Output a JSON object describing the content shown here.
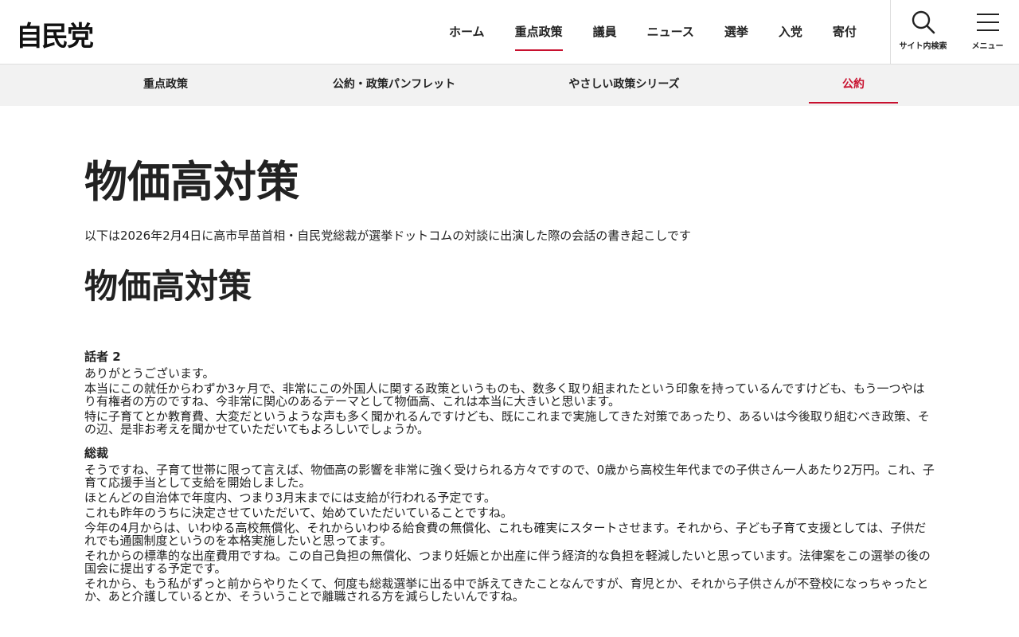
{
  "header": {
    "logo": "自民党",
    "nav": [
      {
        "label": "ホーム"
      },
      {
        "label": "重点政策"
      },
      {
        "label": "議員"
      },
      {
        "label": "ニュース"
      },
      {
        "label": "選挙"
      },
      {
        "label": "入党"
      },
      {
        "label": "寄付"
      }
    ],
    "active_nav": "重点政策",
    "search_label": "サイト内検索",
    "menu_label": "メニュー",
    "accent_color": "#c8102e"
  },
  "subnav": {
    "items": [
      {
        "label": "重点政策"
      },
      {
        "label": "公約・政策パンフレット"
      },
      {
        "label": "やさしい政策シリーズ"
      },
      {
        "label": "公約"
      }
    ],
    "active": "公約"
  },
  "main": {
    "title": "物価高対策",
    "intro": "以下は2026年2月4日に高市早苗首相・自民党総裁が選挙ドットコムの対談に出演した際の会話の書き起こしです",
    "section_title": "物価高対策",
    "speaker1": "話者 2",
    "speaker1_paras": [
      "ありがとうございます。",
      "本当にこの就任からわずか3ヶ月で、非常にこの外国人に関する政策というものも、数多く取り組まれたという印象を持っているんですけども、もう一つやはり有権者の方のですね、今非常に関心のあるテーマとして物価高、これは本当に大きいと思います。",
      "特に子育てとか教育費、大変だというような声も多く聞かれるんですけども、既にこれまで実施してきた対策であったり、あるいは今後取り組むべき政策、その辺、是非お考えを聞かせていただいてもよろしいでしょうか。"
    ],
    "speaker2": "総裁",
    "speaker2_paras": [
      "そうですね、子育て世帯に限って言えば、物価高の影響を非常に強く受けられる方々ですので、0歳から高校生年代までの子供さん一人あたり2万円。これ、子育て応援手当として支給を開始しました。",
      "ほとんどの自治体で年度内、つまり3月末までには支給が行われる予定です。",
      "これも昨年のうちに決定させていただいて、始めていただいていることですね。",
      "今年の4月からは、いわゆる高校無償化、それからいわゆる給食費の無償化、これも確実にスタートさせます。それから、子ども子育て支援としては、子供だれでも通園制度というのを本格実施したいと思ってます。",
      "それからの標準的な出産費用ですね。この自己負担の無償化、つまり妊娠とか出産に伴う経済的な負担を軽減したいと思っています。法律案をこの選挙の後の国会に提出する予定です。",
      "それから、もう私がずっと前からやりたくて、何度も総裁選挙に出る中で訴えてきたことなんですが、育児とか、それから子供さんが不登校になっちゃったとか、あと介護しているとか、そういうことで離職される方を減らしたいんですね。"
    ]
  }
}
